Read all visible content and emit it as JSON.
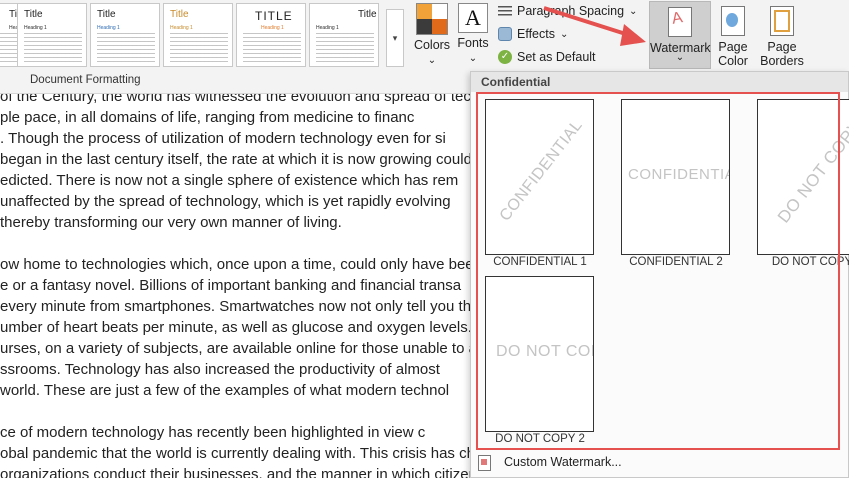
{
  "ribbon": {
    "style_gallery": [
      {
        "title": "Title",
        "heading": "Heading 1"
      },
      {
        "title": "Title",
        "heading": "Heading 1"
      },
      {
        "title": "Title",
        "heading": "Heading 1"
      },
      {
        "title": "TITLE",
        "heading": "Heading 1"
      },
      {
        "title": "Title",
        "heading": "Heading 1"
      }
    ],
    "group_label": "Document Formatting",
    "colors_label": "Colors",
    "fonts_label": "Fonts",
    "fonts_glyph": "A",
    "paragraph_spacing_label": "Paragraph Spacing",
    "effects_label": "Effects",
    "set_as_default_label": "Set as Default",
    "watermark_label": "Watermark",
    "page_color_label_1": "Page",
    "page_color_label_2": "Color",
    "page_borders_label_1": "Page",
    "page_borders_label_2": "Borders",
    "dropdown_caret": "⌄",
    "color_swatches": [
      "#f1a33a",
      "#ffffff",
      "#3b3b3b",
      "#e06a1a"
    ]
  },
  "document": {
    "lines": [
      "of the Century, the world has witnessed the evolution and spread of techn",
      "ple pace, in all domains of life, ranging from medicine to financ",
      ". Though the process of utilization of modern technology even for si",
      " began in the last century itself, the rate at which it is now growing could",
      "edicted. There is now not a single sphere of existence which has rem",
      "unaffected by the spread of technology, which is yet rapidly evolving",
      "thereby transforming our very own manner of living.",
      "",
      "ow home to technologies which, once upon a time, could only have been",
      "e or a fantasy novel. Billions of important banking and financial transa",
      "every minute from smartphones. Smartwatches now not only tell you the",
      "umber of heart beats per minute, as well as glucose and oxygen levels.",
      "urses, on a variety of subjects, are available online for those unable to a",
      "ssrooms. Technology has also increased the productivity of almost",
      " world. These are just a few of the examples of what modern technol",
      "",
      "ce of modern technology has recently been highlighted in view c",
      "obal pandemic that the world is currently dealing with. This crisis has cha",
      "organizations conduct their businesses, and the manner in which citizen"
    ]
  },
  "watermark_panel": {
    "header": "Confidential",
    "items": [
      {
        "caption": "CONFIDENTIAL 1",
        "mark": "CONFIDENTIAL"
      },
      {
        "caption": "CONFIDENTIAL 2",
        "mark": "CONFIDENTIAL"
      },
      {
        "caption": "DO NOT COPY",
        "mark": "DO NOT COPY"
      },
      {
        "caption": "DO NOT COPY 2",
        "mark": "DO NOT COPY"
      }
    ],
    "custom_label": "Custom Watermark...",
    "highlight_color": "#e4514f"
  }
}
